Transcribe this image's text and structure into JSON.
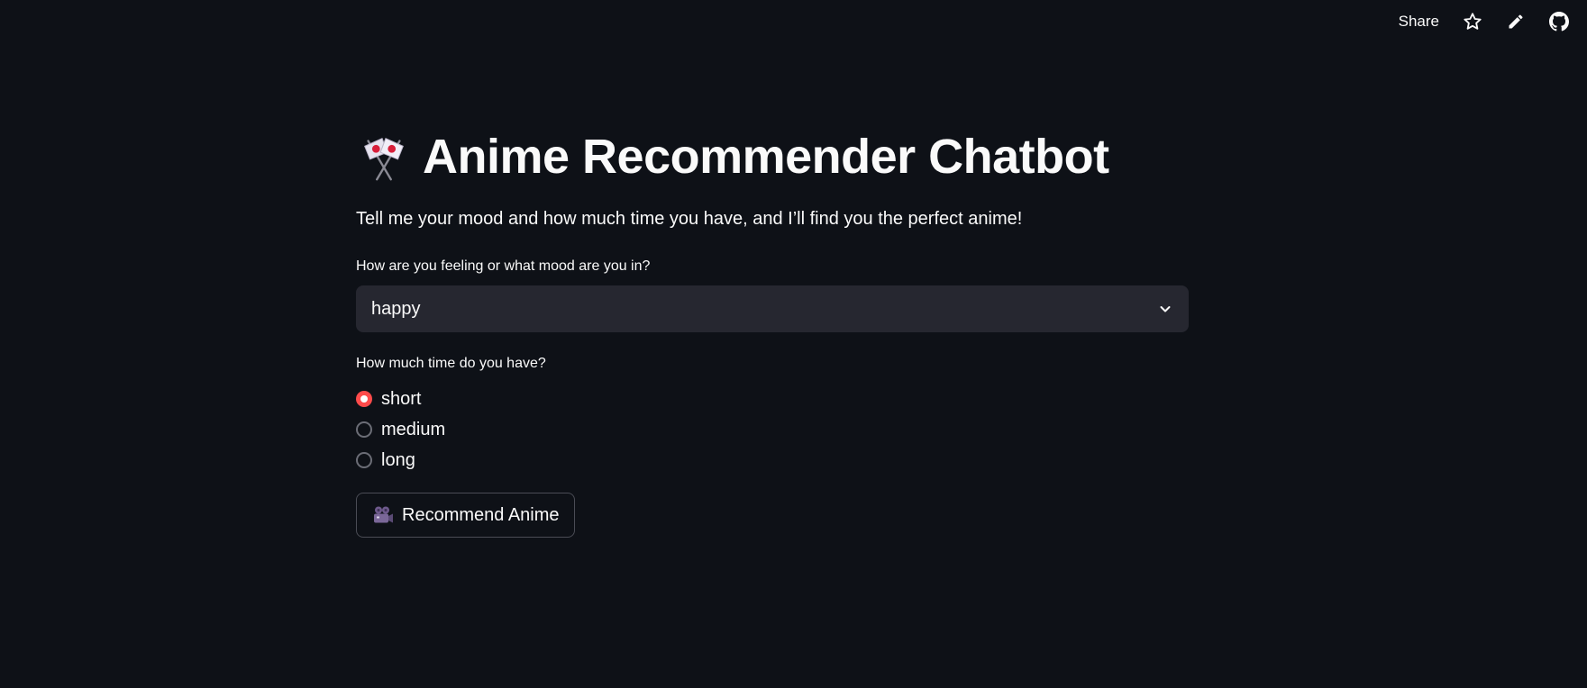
{
  "toolbar": {
    "share_label": "Share",
    "icons": [
      "star-icon",
      "pencil-icon",
      "github-icon"
    ]
  },
  "header": {
    "emoji": "crossed-flags",
    "title": "Anime Recommender Chatbot"
  },
  "intro": "Tell me your mood and how much time you have, and I’ll find you the perfect anime!",
  "mood": {
    "label": "How are you feeling or what mood are you in?",
    "selected": "happy"
  },
  "time": {
    "label": "How much time do you have?",
    "options": [
      "short",
      "medium",
      "long"
    ],
    "selected": "short"
  },
  "recommend_button": {
    "emoji": "movie-camera",
    "label": "Recommend Anime"
  },
  "colors": {
    "background": "#0e1117",
    "input_bg": "#262730",
    "accent": "#ff4b4b",
    "text": "#fafafa"
  }
}
